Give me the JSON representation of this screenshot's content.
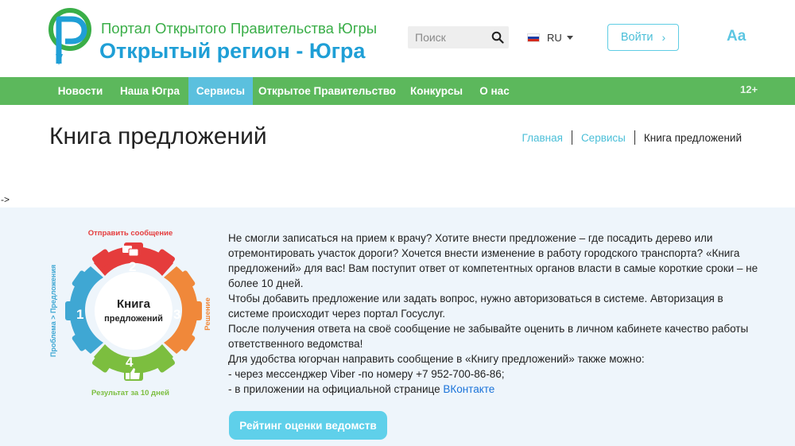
{
  "header": {
    "brand_small": "Портал Открытого Правительства Югры",
    "brand_big": "Открытый регион - Югра",
    "search_placeholder": "Поиск",
    "language": "RU",
    "login_label": "Войти",
    "login_chevron": "›",
    "font_size_label": "Aa"
  },
  "nav": {
    "items": [
      "Новости",
      "Наша Югра",
      "Сервисы",
      "Открытое Правительство",
      "Конкурсы",
      "О нас"
    ],
    "active_index": 2,
    "age_rating": "12+"
  },
  "page": {
    "title": "Книга предложений",
    "stray_text": "->"
  },
  "breadcrumb": {
    "home": "Главная",
    "section": "Сервисы",
    "current": "Книга предложений"
  },
  "diagram": {
    "center_line1": "Книга",
    "center_line2": "предложений",
    "label_top": "Отправить сообщение",
    "label_right": "Решение",
    "label_bottom": "Результат за 10 дней",
    "label_left": "Проблема > Предложения",
    "step1": "1",
    "step2": "2",
    "step3": "3",
    "step4": "4",
    "colors": {
      "top": "#e53c3c",
      "right": "#f0883a",
      "bottom": "#7cbe3f",
      "left": "#3fa7d3"
    }
  },
  "description": {
    "p1": "Не смогли записаться на прием к врачу? Хотите внести предложение – где посадить дерево или отремонтировать участок дороги? Хочется внести изменение в работу городского транспорта? «Книга предложений» для вас! Вам поступит ответ от компетентных органов власти в самые короткие сроки – не более 10 дней.",
    "p2": "Чтобы добавить предложение или задать вопрос, нужно авторизоваться в системе. Авторизация в системе происходит через портал Госуслуг.",
    "p3": "После получения ответа на своё сообщение не забывайте оценить в личном кабинете качество работы ответственного ведомства!",
    "p4": "Для удобства югорчан направить сообщение в «Книгу предложений» также можно:",
    "p5": "- через мессенджер Viber -по номеру +7 952-700-86-86;",
    "p6_prefix": "- в приложении на официальной странице ",
    "p6_link": "ВКонтакте"
  },
  "rating_button": "Рейтинг оценки ведомств"
}
